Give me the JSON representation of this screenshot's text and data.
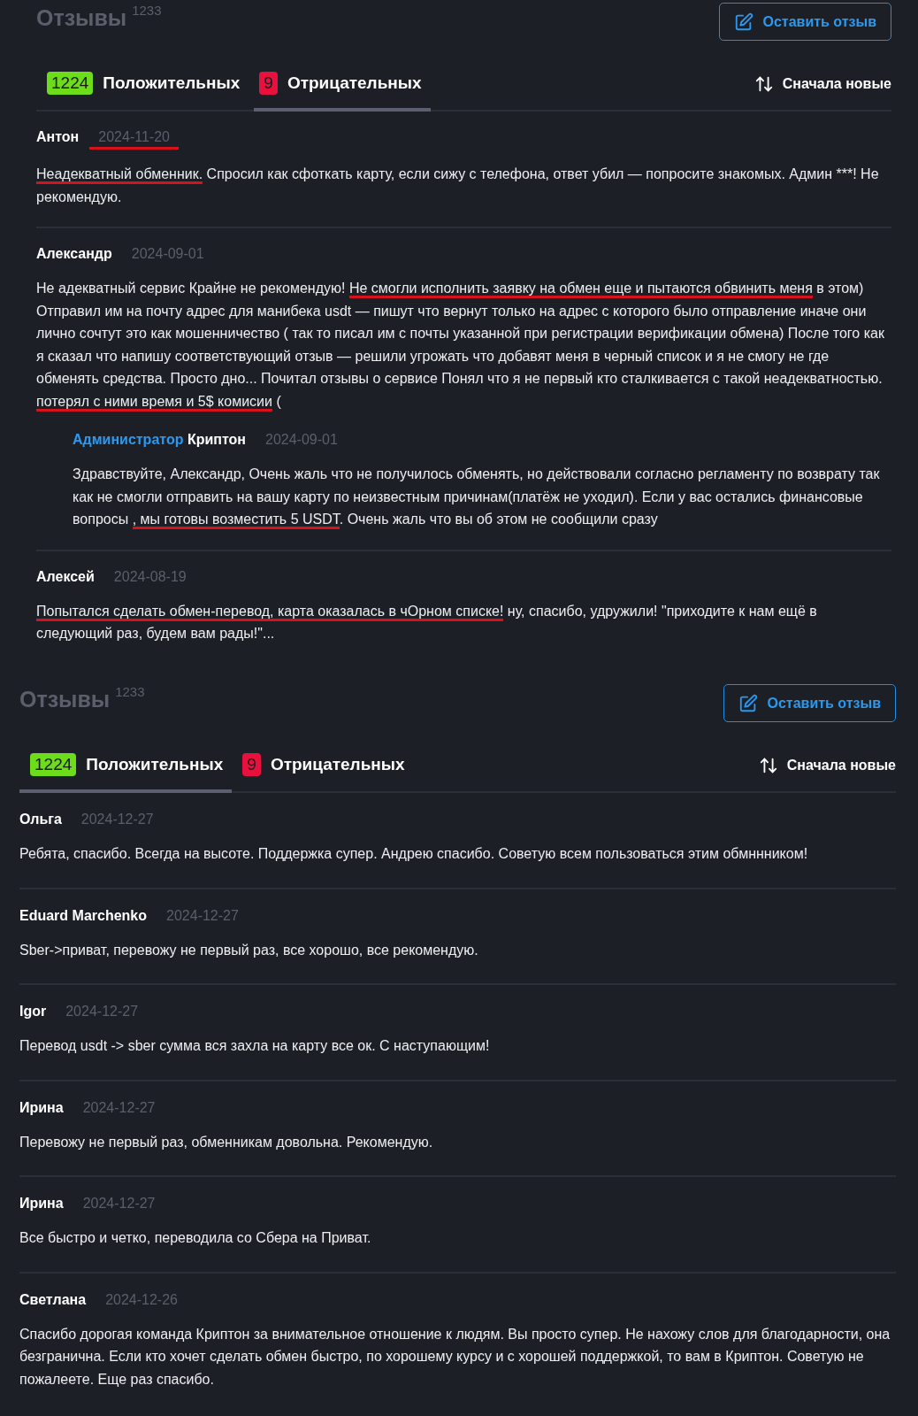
{
  "panels": [
    {
      "title": "Отзывы",
      "count": "1233",
      "button": "Оставить отзыв",
      "sort": "Сначала новые",
      "tabs": [
        {
          "badge": "1224",
          "label": "Положительных",
          "color": "#6ddc1a",
          "selected": false
        },
        {
          "badge": "9",
          "label": "Отрицательных",
          "color": "#e8103c",
          "selected": true
        }
      ],
      "reviews": [
        {
          "author": "Антон",
          "date": "2024-11-20",
          "date_underlined": true,
          "segments": [
            {
              "text": "Неадекватный обменник.",
              "underlined": true
            },
            {
              "text": " Спросил как сфоткать карту, если сижу с телефона, ответ убил — попросите знакомых. Админ ***! Не рекомендую.",
              "underlined": false
            }
          ]
        },
        {
          "author": "Александр",
          "date": "2024-09-01",
          "date_underlined": false,
          "segments": [
            {
              "text": "Не адекватный сервис Крайне не рекомендую! ",
              "underlined": false
            },
            {
              "text": "Не смогли исполнить заявку на обмен еще и пытаются обвинить меня",
              "underlined": true
            },
            {
              "text": " в этом) Отправил им на почту адрес для манибека usdt — пишут что вернут только на адрес с которого было отправление иначе они лично сочтут это как мошенничество ( так то писал им с почты указанной при регистрации верификации обмена) После того как я сказал что напишу соответствующий отзыв — решили угрожать что добавят меня в черный список и я не смогу не где обменять средства. Просто дно... Почитал отзывы о сервисе Понял что я не первый кто сталкивается с такой неадекватностью. ",
              "underlined": false
            },
            {
              "text": "потерял с ними время и 5$ комисии",
              "underlined": true
            },
            {
              "text": " (",
              "underlined": false
            }
          ],
          "replies": [
            {
              "role": "Администратор",
              "author": "Криптон",
              "date": "2024-09-01",
              "date_underlined": false,
              "segments": [
                {
                  "text": "Здравствуйте, Александр, Очень жаль что не получилось обменять, но действовали согласно регламенту по возврату так как не смогли отправить на вашу карту по неизвестным причинам(платёж не уходил). Если у вас остались финансовые вопросы ",
                  "underlined": false
                },
                {
                  "text": ", мы готовы возместить 5 USDT",
                  "underlined": true
                },
                {
                  "text": ". Очень жаль что вы об этом не сообщили сразу",
                  "underlined": false
                }
              ]
            }
          ]
        },
        {
          "author": "Алексей",
          "date": "2024-08-19",
          "date_underlined": false,
          "segments": [
            {
              "text": "Попытался сделать обмен-перевод, карта оказалась в чОрном списке!",
              "underlined": true
            },
            {
              "text": " ну, спасибо, удружили! \"приходите к нам ещё в следующий раз, будем вам рады!\"...",
              "underlined": false
            }
          ]
        }
      ]
    },
    {
      "title": "Отзывы",
      "count": "1233",
      "button": "Оставить отзыв",
      "sort": "Сначала новые",
      "tabs": [
        {
          "badge": "1224",
          "label": "Положительных",
          "color": "#6ddc1a",
          "selected": true
        },
        {
          "badge": "9",
          "label": "Отрицательных",
          "color": "#e8103c",
          "selected": false
        }
      ],
      "reviews": [
        {
          "author": "Ольга",
          "date": "2024-12-27",
          "date_underlined": false,
          "segments": [
            {
              "text": "Ребята, спасибо. Всегда на высоте. Поддержка супер. Андрею спасибо. Советую всем пользоваться этим обмннником!",
              "underlined": false
            }
          ]
        },
        {
          "author": "Eduard Marchenko",
          "date": "2024-12-27",
          "date_underlined": false,
          "segments": [
            {
              "text": "Sber->приват, перевожу не первый раз, все хорошо, все рекомендую.",
              "underlined": false
            }
          ]
        },
        {
          "author": "Igor",
          "date": "2024-12-27",
          "date_underlined": false,
          "segments": [
            {
              "text": "Перевод usdt -> sber сумма вся захла на карту все ок. С наступающим!",
              "underlined": false
            }
          ]
        },
        {
          "author": "Ирина",
          "date": "2024-12-27",
          "date_underlined": false,
          "segments": [
            {
              "text": "Перевожу не первый раз, обменникам довольна. Рекомендую.",
              "underlined": false
            }
          ]
        },
        {
          "author": "Ирина",
          "date": "2024-12-27",
          "date_underlined": false,
          "segments": [
            {
              "text": "Все быстро и четко, переводила со Сбера на Приват.",
              "underlined": false
            }
          ]
        },
        {
          "author": "Светлана",
          "date": "2024-12-26",
          "date_underlined": false,
          "segments": [
            {
              "text": "Спасибо дорогая команда Криптон за внимательное отношение к людям. Вы просто супер. Не нахожу слов для благодарности, она безгранична. Если кто хочет сделать обмен быстро, по хорошему курсу и с хорошей поддержкой, то вам в Криптон. Советую не пожалеете. Еще раз спасибо.",
              "underlined": false
            }
          ]
        }
      ]
    }
  ]
}
